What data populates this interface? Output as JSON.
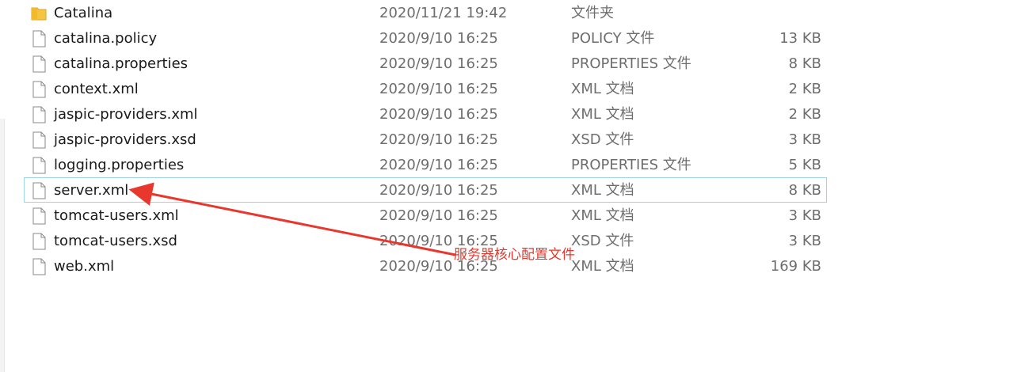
{
  "files": [
    {
      "name": "Catalina",
      "date": "2020/11/21 19:42",
      "type": "文件夹",
      "size": "",
      "icon": "folder-icon",
      "highlighted": false
    },
    {
      "name": "catalina.policy",
      "date": "2020/9/10 16:25",
      "type": "POLICY 文件",
      "size": "13 KB",
      "icon": "file-icon",
      "highlighted": false
    },
    {
      "name": "catalina.properties",
      "date": "2020/9/10 16:25",
      "type": "PROPERTIES 文件",
      "size": "8 KB",
      "icon": "file-icon",
      "highlighted": false
    },
    {
      "name": "context.xml",
      "date": "2020/9/10 16:25",
      "type": "XML 文档",
      "size": "2 KB",
      "icon": "file-icon",
      "highlighted": false
    },
    {
      "name": "jaspic-providers.xml",
      "date": "2020/9/10 16:25",
      "type": "XML 文档",
      "size": "2 KB",
      "icon": "file-icon",
      "highlighted": false
    },
    {
      "name": "jaspic-providers.xsd",
      "date": "2020/9/10 16:25",
      "type": "XSD 文件",
      "size": "3 KB",
      "icon": "file-icon",
      "highlighted": false
    },
    {
      "name": "logging.properties",
      "date": "2020/9/10 16:25",
      "type": "PROPERTIES 文件",
      "size": "5 KB",
      "icon": "file-icon",
      "highlighted": false
    },
    {
      "name": "server.xml",
      "date": "2020/9/10 16:25",
      "type": "XML 文档",
      "size": "8 KB",
      "icon": "file-icon",
      "highlighted": true
    },
    {
      "name": "tomcat-users.xml",
      "date": "2020/9/10 16:25",
      "type": "XML 文档",
      "size": "3 KB",
      "icon": "file-icon",
      "highlighted": false
    },
    {
      "name": "tomcat-users.xsd",
      "date": "2020/9/10 16:25",
      "type": "XSD 文件",
      "size": "3 KB",
      "icon": "file-icon",
      "highlighted": false
    },
    {
      "name": "web.xml",
      "date": "2020/9/10 16:25",
      "type": "XML 文档",
      "size": "169 KB",
      "icon": "file-icon",
      "highlighted": false
    }
  ],
  "annotation": {
    "label": "服务器核心配置文件",
    "color": "#e8372c"
  },
  "colors": {
    "hover_border": "#9ed4e6",
    "folder": "#f5c542",
    "meta_text": "#6d6d6d"
  }
}
